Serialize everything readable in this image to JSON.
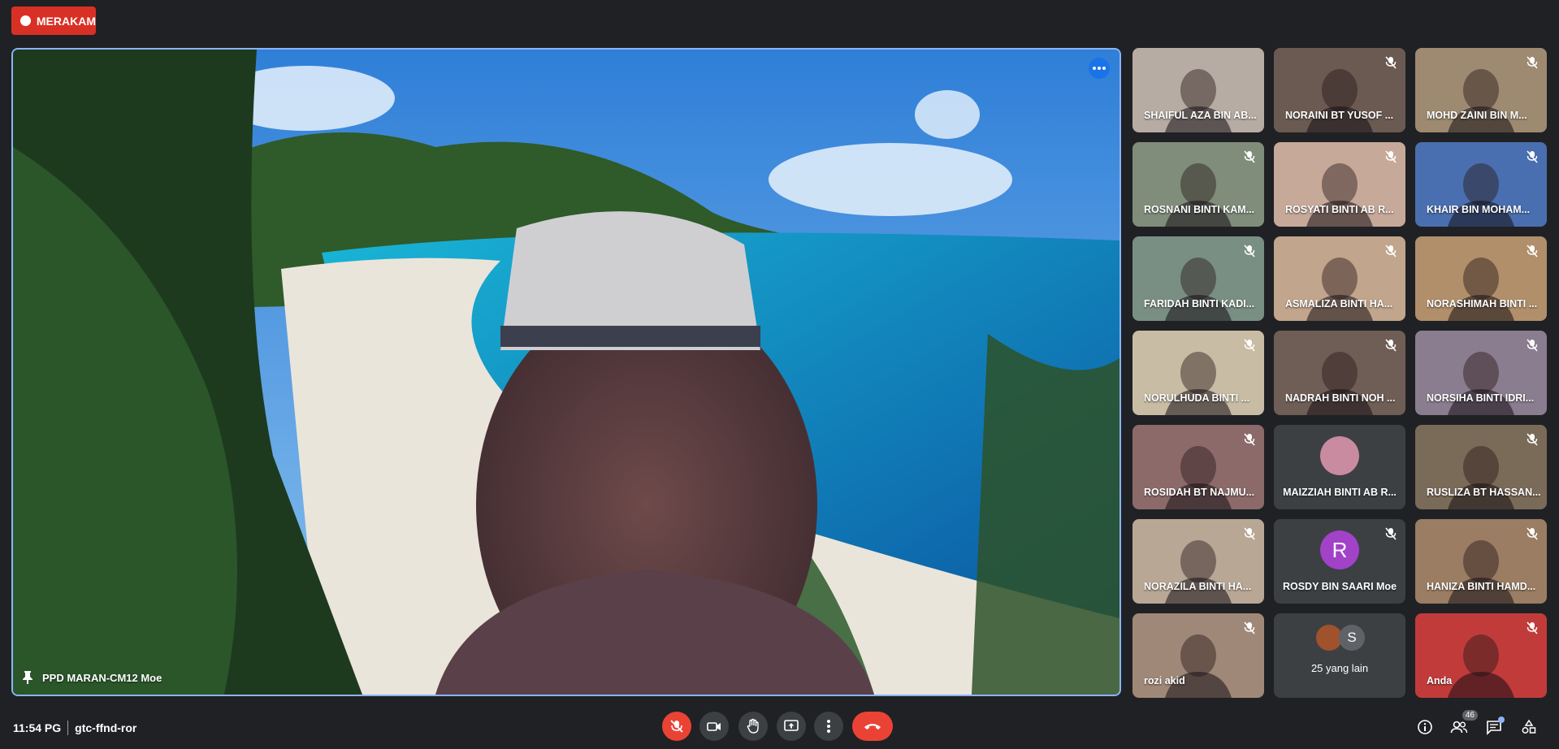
{
  "recording": {
    "label": "MERAKAM",
    "color": "#d93025"
  },
  "main": {
    "participant": "PPD MARAN-CM12 Moe",
    "pin_icon": "pin-icon",
    "more_icon": "more-options-icon"
  },
  "participants": [
    {
      "name": "SHAIFUL AZA BIN AB...",
      "muted": false,
      "photo": "#b7aca3"
    },
    {
      "name": "NORAINI BT YUSOF ...",
      "muted": true,
      "photo": "#6b5a52"
    },
    {
      "name": "MOHD ZAINI BIN M...",
      "muted": true,
      "photo": "#9d8a70"
    },
    {
      "name": "ROSNANI BINTI KAM...",
      "muted": true,
      "photo": "#7f8d7a"
    },
    {
      "name": "ROSYATI BINTI AB R...",
      "muted": true,
      "photo": "#c7a99a"
    },
    {
      "name": "KHAIR BIN MOHAM...",
      "muted": true,
      "photo": "#4a6fb0"
    },
    {
      "name": "FARIDAH BINTI KADI...",
      "muted": true,
      "photo": "#7a8f84"
    },
    {
      "name": "ASMALIZA BINTI HA...",
      "muted": true,
      "photo": "#c1a58c"
    },
    {
      "name": "NORASHIMAH BINTI ...",
      "muted": true,
      "photo": "#b08f6a"
    },
    {
      "name": "NORULHUDA BINTI ...",
      "muted": true,
      "photo": "#c8bca4"
    },
    {
      "name": "NADRAH BINTI NOH ...",
      "muted": true,
      "photo": "#6f5e55"
    },
    {
      "name": "NORSIHA BINTI IDRI...",
      "muted": true,
      "photo": "#8a7d8f"
    },
    {
      "name": "ROSIDAH BT NAJMU...",
      "muted": true,
      "photo": "#8c6a6a"
    },
    {
      "name": "MAIZZIAH BINTI AB R...",
      "muted": false,
      "avatar_color": "#3c4043"
    },
    {
      "name": "RUSLIZA BT HASSAN...",
      "muted": true,
      "photo": "#7a6a58"
    },
    {
      "name": "NORAZILA BINTI HA...",
      "muted": true,
      "photo": "#b8a795"
    },
    {
      "name": "ROSDY BIN SAARI Moe",
      "muted": true,
      "avatar_letter": "R",
      "avatar_color": "#a142c8"
    },
    {
      "name": "HANIZA BINTI HAMD...",
      "muted": true,
      "photo": "#9a7d63"
    },
    {
      "name": "rozi akid",
      "muted": true,
      "photo": "#a08878"
    },
    {
      "name": "25 yang lain",
      "others_letter": "S"
    },
    {
      "name": "Anda",
      "muted": true,
      "photo": "#c23b3b"
    }
  ],
  "bottom": {
    "time": "11:54 PG",
    "meeting_code": "gtc-ffnd-ror",
    "people_count": "46"
  }
}
